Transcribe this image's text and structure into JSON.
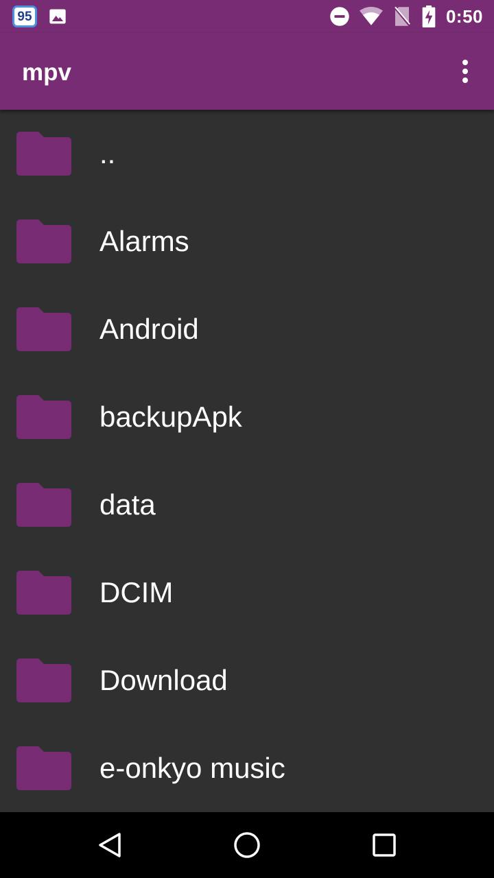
{
  "status_bar": {
    "notification_badge": "95",
    "time": "0:50",
    "icons": [
      "notification-95-icon",
      "image-icon",
      "do-not-disturb-icon",
      "wifi-icon",
      "no-sim-icon",
      "battery-charging-icon"
    ]
  },
  "app_bar": {
    "title": "mpv",
    "menu_icon": "more-vert-icon"
  },
  "files": [
    {
      "name": "..",
      "icon": "folder-icon"
    },
    {
      "name": "Alarms",
      "icon": "folder-icon"
    },
    {
      "name": "Android",
      "icon": "folder-icon"
    },
    {
      "name": "backupApk",
      "icon": "folder-icon"
    },
    {
      "name": "data",
      "icon": "folder-icon"
    },
    {
      "name": "DCIM",
      "icon": "folder-icon"
    },
    {
      "name": "Download",
      "icon": "folder-icon"
    },
    {
      "name": "e-onkyo music",
      "icon": "folder-icon"
    }
  ],
  "nav_bar": {
    "back_icon": "back-icon",
    "home_icon": "home-icon",
    "recents_icon": "recents-icon"
  },
  "colors": {
    "primary": "#772c73",
    "background": "#303030",
    "folder": "#772c73",
    "text": "#ffffff",
    "nav_bar": "#000000"
  }
}
